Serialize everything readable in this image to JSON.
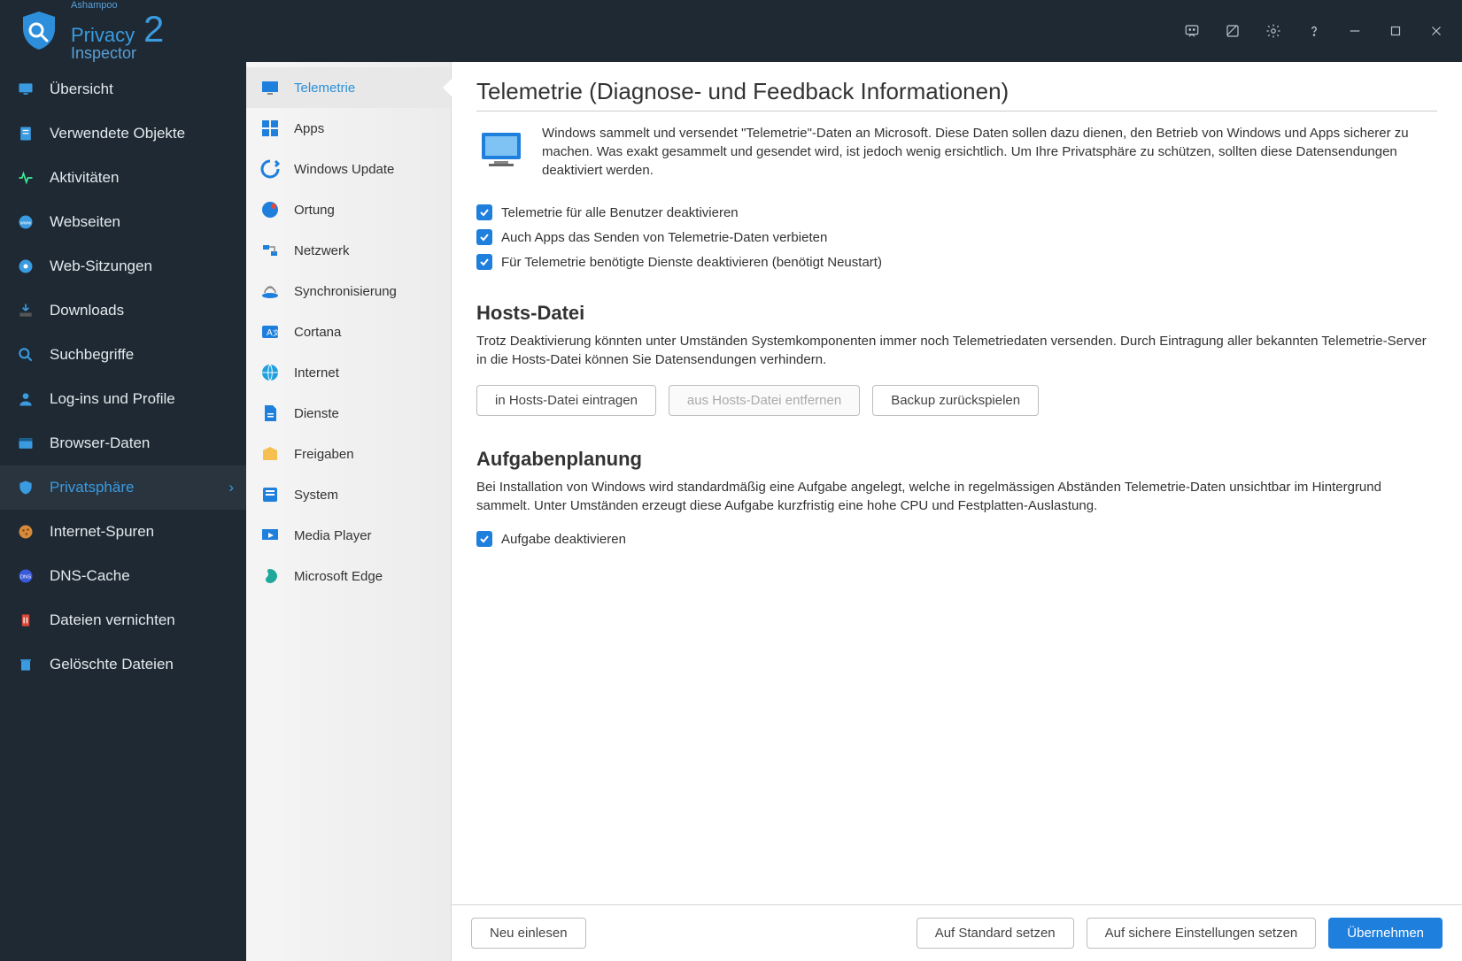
{
  "brand": {
    "company": "Ashampoo",
    "name": "Privacy",
    "sub": "Inspector",
    "version": "2"
  },
  "sidebar": {
    "items": [
      {
        "label": "Übersicht",
        "icon": "monitor"
      },
      {
        "label": "Verwendete Objekte",
        "icon": "document"
      },
      {
        "label": "Aktivitäten",
        "icon": "activity"
      },
      {
        "label": "Webseiten",
        "icon": "globe"
      },
      {
        "label": "Web-Sitzungen",
        "icon": "session"
      },
      {
        "label": "Downloads",
        "icon": "download"
      },
      {
        "label": "Suchbegriffe",
        "icon": "search"
      },
      {
        "label": "Log-ins und Profile",
        "icon": "user"
      },
      {
        "label": "Browser-Daten",
        "icon": "browser"
      },
      {
        "label": "Privatsphäre",
        "icon": "shield",
        "active": true
      },
      {
        "label": "Internet-Spuren",
        "icon": "cookie"
      },
      {
        "label": "DNS-Cache",
        "icon": "dns"
      },
      {
        "label": "Dateien vernichten",
        "icon": "shred"
      },
      {
        "label": "Gelöschte Dateien",
        "icon": "trash"
      }
    ]
  },
  "midnav": {
    "items": [
      {
        "label": "Telemetrie",
        "active": true
      },
      {
        "label": "Apps"
      },
      {
        "label": "Windows Update"
      },
      {
        "label": "Ortung"
      },
      {
        "label": "Netzwerk"
      },
      {
        "label": "Synchronisierung"
      },
      {
        "label": "Cortana"
      },
      {
        "label": "Internet"
      },
      {
        "label": "Dienste"
      },
      {
        "label": "Freigaben"
      },
      {
        "label": "System"
      },
      {
        "label": "Media Player"
      },
      {
        "label": "Microsoft Edge"
      }
    ]
  },
  "content": {
    "title": "Telemetrie (Diagnose- und Feedback Informationen)",
    "intro": "Windows sammelt und versendet \"Telemetrie\"-Daten an Microsoft. Diese Daten sollen dazu dienen, den Betrieb von Windows und Apps sicherer zu machen. Was exakt gesammelt und gesendet wird, ist jedoch wenig ersichtlich. Um Ihre Privatsphäre zu schützen, sollten diese Datensendungen deaktiviert werden.",
    "checks": [
      {
        "label": "Telemetrie für alle Benutzer deaktivieren",
        "checked": true
      },
      {
        "label": "Auch Apps das Senden von Telemetrie-Daten verbieten",
        "checked": true
      },
      {
        "label": "Für Telemetrie benötigte Dienste deaktivieren (benötigt Neustart)",
        "checked": true
      }
    ],
    "hosts": {
      "title": "Hosts-Datei",
      "desc": "Trotz Deaktivierung könnten unter Umständen Systemkomponenten immer noch Telemetriedaten versenden. Durch Eintragung aller bekannten Telemetrie-Server in die Hosts-Datei können Sie Datensendungen verhindern.",
      "btn_add": "in Hosts-Datei eintragen",
      "btn_remove": "aus Hosts-Datei entfernen",
      "btn_restore": "Backup zurückspielen"
    },
    "tasks": {
      "title": "Aufgabenplanung",
      "desc": "Bei Installation von Windows wird standardmäßig eine Aufgabe angelegt, welche in regelmässigen Abständen Telemetrie-Daten unsichtbar im Hintergrund sammelt. Unter Umständen erzeugt diese Aufgabe kurzfristig eine hohe CPU und Festplatten-Auslastung.",
      "check_label": "Aufgabe deaktivieren"
    }
  },
  "footer": {
    "reload": "Neu einlesen",
    "reset_default": "Auf Standard setzen",
    "secure": "Auf sichere Einstellungen setzen",
    "apply": "Übernehmen"
  }
}
